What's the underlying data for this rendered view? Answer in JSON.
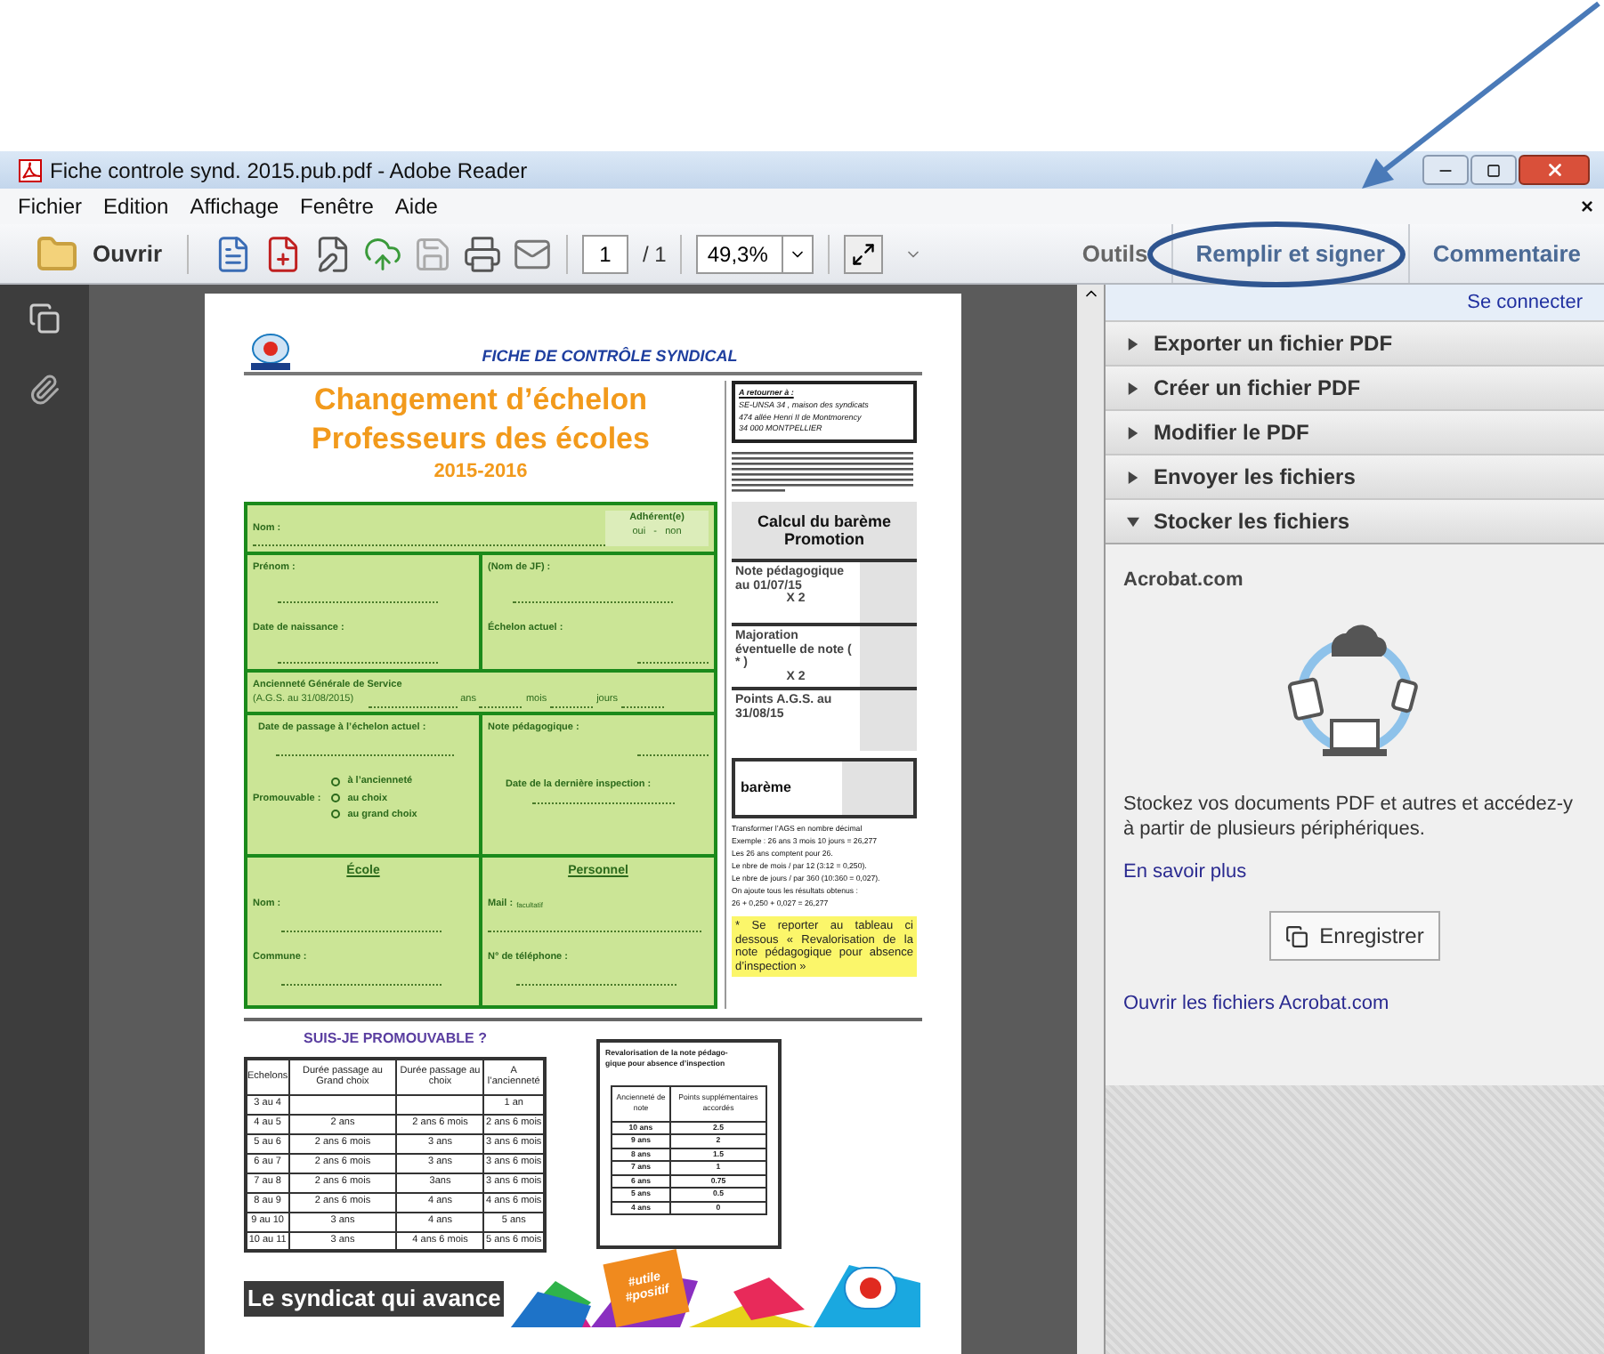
{
  "window": {
    "title": "Fiche controle synd. 2015.pub.pdf - Adobe Reader"
  },
  "menu": [
    {
      "label": "Fichier"
    },
    {
      "label": "Edition"
    },
    {
      "label": "Affichage"
    },
    {
      "label": "Fenêtre"
    },
    {
      "label": "Aide"
    }
  ],
  "menu_close": "×",
  "toolbar": {
    "open": "Ouvrir",
    "page": "1",
    "page_total": "/ 1",
    "zoom": "49,3%",
    "tabs": [
      {
        "label": "Outils",
        "selected": false
      },
      {
        "label": "Remplir et signer",
        "selected": false
      },
      {
        "label": "Commentaire",
        "selected": false
      }
    ]
  },
  "document": {
    "header": "FICHE DE CONTRÔLE SYNDICAL",
    "title_lines": [
      "Changement d’échelon",
      "Professeurs des écoles"
    ],
    "year": "2015-2016",
    "form": {
      "nom": "Nom :",
      "adherent": "Adhérent(e)",
      "adherent_choices": "oui   -   non",
      "prenom": "Prénom :",
      "nom_jf": "(Nom de JF) :",
      "naissance": "Date de naissance :",
      "echelon": "Échelon actuel :",
      "ags_title": "Ancienneté Générale de Service",
      "ags_sub": "(A.G.S. au 31/08/2015)",
      "ags_units": [
        "ans",
        "mois",
        "jours"
      ],
      "passage": "Date de passage à l’échelon actuel :",
      "promouvable": "Promouvable :",
      "options": [
        {
          "label": "à l’ancienneté",
          "selected": false
        },
        {
          "label": "au choix",
          "selected": false
        },
        {
          "label": "au grand choix",
          "selected": false
        }
      ],
      "note": "Note pédagogique :",
      "inspection": "Date de la dernière inspection :",
      "ecole": "École",
      "personnel": "Personnel",
      "ecole_nom": "Nom :",
      "mail": "Mail :",
      "mail_hint": "facultatif",
      "commune": "Commune :",
      "telephone": "N° de téléphone :"
    },
    "address": {
      "heading": "A retourner à :",
      "lines": [
        "SE-UNSA 34 , maison des syndicats",
        "474 allée Henri II de Montmorency",
        "34 000 MONTPELLIER"
      ]
    },
    "bareme": {
      "title": "Calcul du barème Promotion",
      "rows": [
        {
          "label": "Note pédagogique au 01/07/15",
          "factor": "X 2"
        },
        {
          "label": "Majoration éventuelle de note ( * )",
          "factor": "X 2"
        },
        {
          "label": "Points A.G.S. au 31/08/15"
        }
      ],
      "total": "barème",
      "explanation": [
        "Transformer l’AGS en nombre décimal",
        "Exemple : 26 ans 3 mois 10 jours = 26,277",
        "Les 26 ans comptent pour 26.",
        "Le nbre de mois / par 12 (3:12 = 0,250).",
        "Le nbre de jours / par 360 (10:360 = 0,027).",
        "On ajoute tous les résultats obtenus :",
        "26 + 0,250 + 0,027 = 26,277"
      ],
      "footnote": "*   Se reporter au tableau ci dessous « Revalorisation de la note pédagogique pour absence d’inspection »"
    },
    "promo": {
      "title": "SUIS-JE PROMOUVABLE ?",
      "columns": [
        "Echelons",
        "Durée passage au Grand choix",
        "Durée passage au choix",
        "A l’ancienneté"
      ],
      "rows": [
        [
          "3 au 4",
          null,
          null,
          "1 an"
        ],
        [
          "4 au 5",
          "2 ans",
          "2 ans 6 mois",
          "2 ans 6 mois"
        ],
        [
          "5 au 6",
          "2 ans 6 mois",
          "3 ans",
          "3 ans 6 mois"
        ],
        [
          "6 au 7",
          "2 ans 6 mois",
          "3 ans",
          "3 ans 6 mois"
        ],
        [
          "7 au 8",
          "2 ans 6 mois",
          "3ans",
          "3 ans 6 mois"
        ],
        [
          "8 au 9",
          "2 ans 6 mois",
          "4 ans",
          "4 ans 6 mois"
        ],
        [
          "9 au 10",
          "3 ans",
          "4 ans",
          "5 ans"
        ],
        [
          "10 au 11",
          "3 ans",
          "4 ans 6 mois",
          "5 ans 6 mois"
        ]
      ]
    },
    "revalo": {
      "title_lines": [
        "Revalorisation de la note pédago-",
        "gique pour absence d’inspection"
      ],
      "columns": [
        "Ancienneté de note",
        "Points supplémentaires accordés"
      ],
      "rows": [
        [
          "10 ans",
          "2.5"
        ],
        [
          "9 ans",
          "2"
        ],
        [
          "8 ans",
          "1.5"
        ],
        [
          "7 ans",
          "1"
        ],
        [
          "6 ans",
          "0.75"
        ],
        [
          "5 ans",
          "0.5"
        ],
        [
          "4 ans",
          "0"
        ]
      ]
    },
    "banner": {
      "slogan": "Le syndicat qui avance",
      "tags": [
        "#utile",
        "#positif"
      ]
    }
  },
  "tasks_pane": {
    "sign_in": "Se connecter",
    "sections": [
      {
        "label": "Exporter un fichier PDF",
        "expanded": false
      },
      {
        "label": "Créer un fichier PDF",
        "expanded": false
      },
      {
        "label": "Modifier le PDF",
        "expanded": false
      },
      {
        "label": "Envoyer les fichiers",
        "expanded": false
      },
      {
        "label": "Stocker les fichiers",
        "expanded": true
      }
    ],
    "panel": {
      "title": "Acrobat.com",
      "description": "Stockez vos documents PDF et autres et accédez-y à partir de plusieurs périphériques.",
      "learn_more": "En savoir plus",
      "button": "Enregistrer",
      "open_link": "Ouvrir les fichiers Acrobat.com"
    }
  }
}
